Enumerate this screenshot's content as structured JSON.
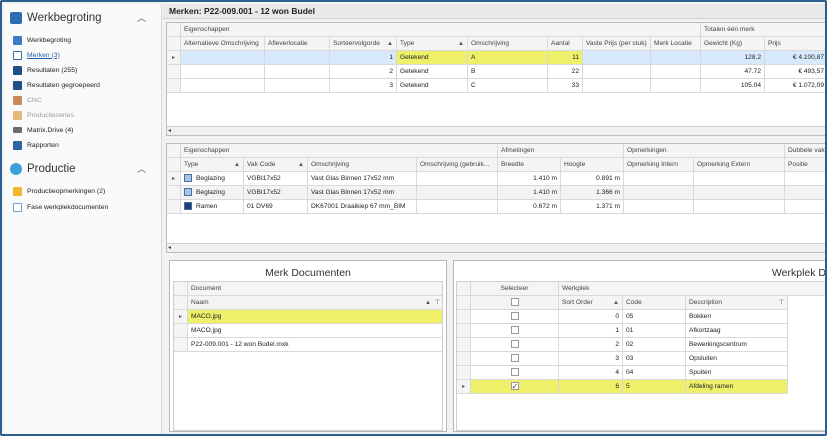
{
  "sidebar": {
    "group1": {
      "title": "Werkbegroting"
    },
    "items1": [
      {
        "label": "Werkbegroting"
      },
      {
        "label": "Merken (3)"
      },
      {
        "label": "Resultaten (255)"
      },
      {
        "label": "Resultaten gegroepeerd"
      },
      {
        "label": "CNC"
      },
      {
        "label": "Productieseries"
      },
      {
        "label": "Matrix.Drive (4)"
      },
      {
        "label": "Rapporten"
      }
    ],
    "group2": {
      "title": "Productie"
    },
    "items2": [
      {
        "label": "Productieopmerkingen (2)"
      },
      {
        "label": "Fase werkplekdocumenten"
      }
    ]
  },
  "main": {
    "title": "Merken: P22-009.001 - 12 won Budel"
  },
  "grid1": {
    "band_left": "Eigenschappen",
    "band_right": "Totalen één merk",
    "columns": [
      "Alternatieve Omschrijving",
      "Afleverlocatie",
      "Sorteervolgorde",
      "Type",
      "Omschrijving",
      "Aantal",
      "Vaste Prijs (per stuk)",
      "Merk Locatie",
      "Gewicht (Kg)",
      "Prijs"
    ],
    "rows": [
      {
        "sort": "1",
        "type": "Getekend",
        "omschrijving": "A",
        "aantal": "11",
        "gewicht": "128.2",
        "prijs": "€ 4.100,87"
      },
      {
        "sort": "2",
        "type": "Getekend",
        "omschrijving": "B",
        "aantal": "22",
        "gewicht": "47.72",
        "prijs": "€ 493,57"
      },
      {
        "sort": "3",
        "type": "Getekend",
        "omschrijving": "C",
        "aantal": "33",
        "gewicht": "105.04",
        "prijs": "€ 1.072,09"
      }
    ]
  },
  "grid2": {
    "band_left": "Eigenschappen",
    "band_mid": "Afmetingen",
    "band_right": "Opmerkingen",
    "band_far": "Dubbele vakk",
    "columns": [
      "Type",
      "Vak Code",
      "Omschrijving",
      "Omschrijving (gebruik...",
      "Breedte",
      "Hoogte",
      "Opmerking Intern",
      "Opmerking Extern",
      "Positie"
    ],
    "rows": [
      {
        "type": "Beglazing",
        "icon": "glass-icon",
        "vak": "VGBI17x52",
        "omschrijving": "Vast Glas Binnen 17x52 mm",
        "breedte": "1.410 m",
        "hoogte": "0.891 m"
      },
      {
        "type": "Beglazing",
        "icon": "glass-icon",
        "vak": "VGBI17x52",
        "omschrijving": "Vast Glas Binnen 17x52 mm",
        "breedte": "1.410 m",
        "hoogte": "1.366 m"
      },
      {
        "type": "Ramen",
        "icon": "window-icon",
        "vak": "01 DV69",
        "omschrijving": "DK67001 Draaikiep 67 mm_BIM",
        "breedte": "0.672 m",
        "hoogte": "1.371 m"
      }
    ]
  },
  "docs": {
    "title": "Merk Documenten",
    "band": "Document",
    "column": "Naam",
    "rows": [
      "MACO.jpg",
      "MACO.jpg",
      "P22-009.001 - 12 won Budel.mxk"
    ]
  },
  "werkplek": {
    "title": "Werkplek D",
    "band_left": "Selecteer",
    "band_right": "Werkplek",
    "columns": [
      "Sort Order",
      "Code",
      "Description"
    ],
    "rows": [
      {
        "order": "0",
        "code": "05",
        "desc": "Bokken",
        "checked": false
      },
      {
        "order": "1",
        "code": "01",
        "desc": "Afkortzaag",
        "checked": false
      },
      {
        "order": "2",
        "code": "02",
        "desc": "Bewerkingscentrum",
        "checked": false
      },
      {
        "order": "3",
        "code": "03",
        "desc": "Opsluiten",
        "checked": false
      },
      {
        "order": "4",
        "code": "04",
        "desc": "Spuiten",
        "checked": false
      },
      {
        "order": "6",
        "code": "5",
        "desc": "Afdeling ramen",
        "checked": true
      }
    ]
  },
  "colors": {
    "highlight": "#eef06a",
    "selection": "#d7e9fb",
    "frame": "#2a5f8f"
  }
}
